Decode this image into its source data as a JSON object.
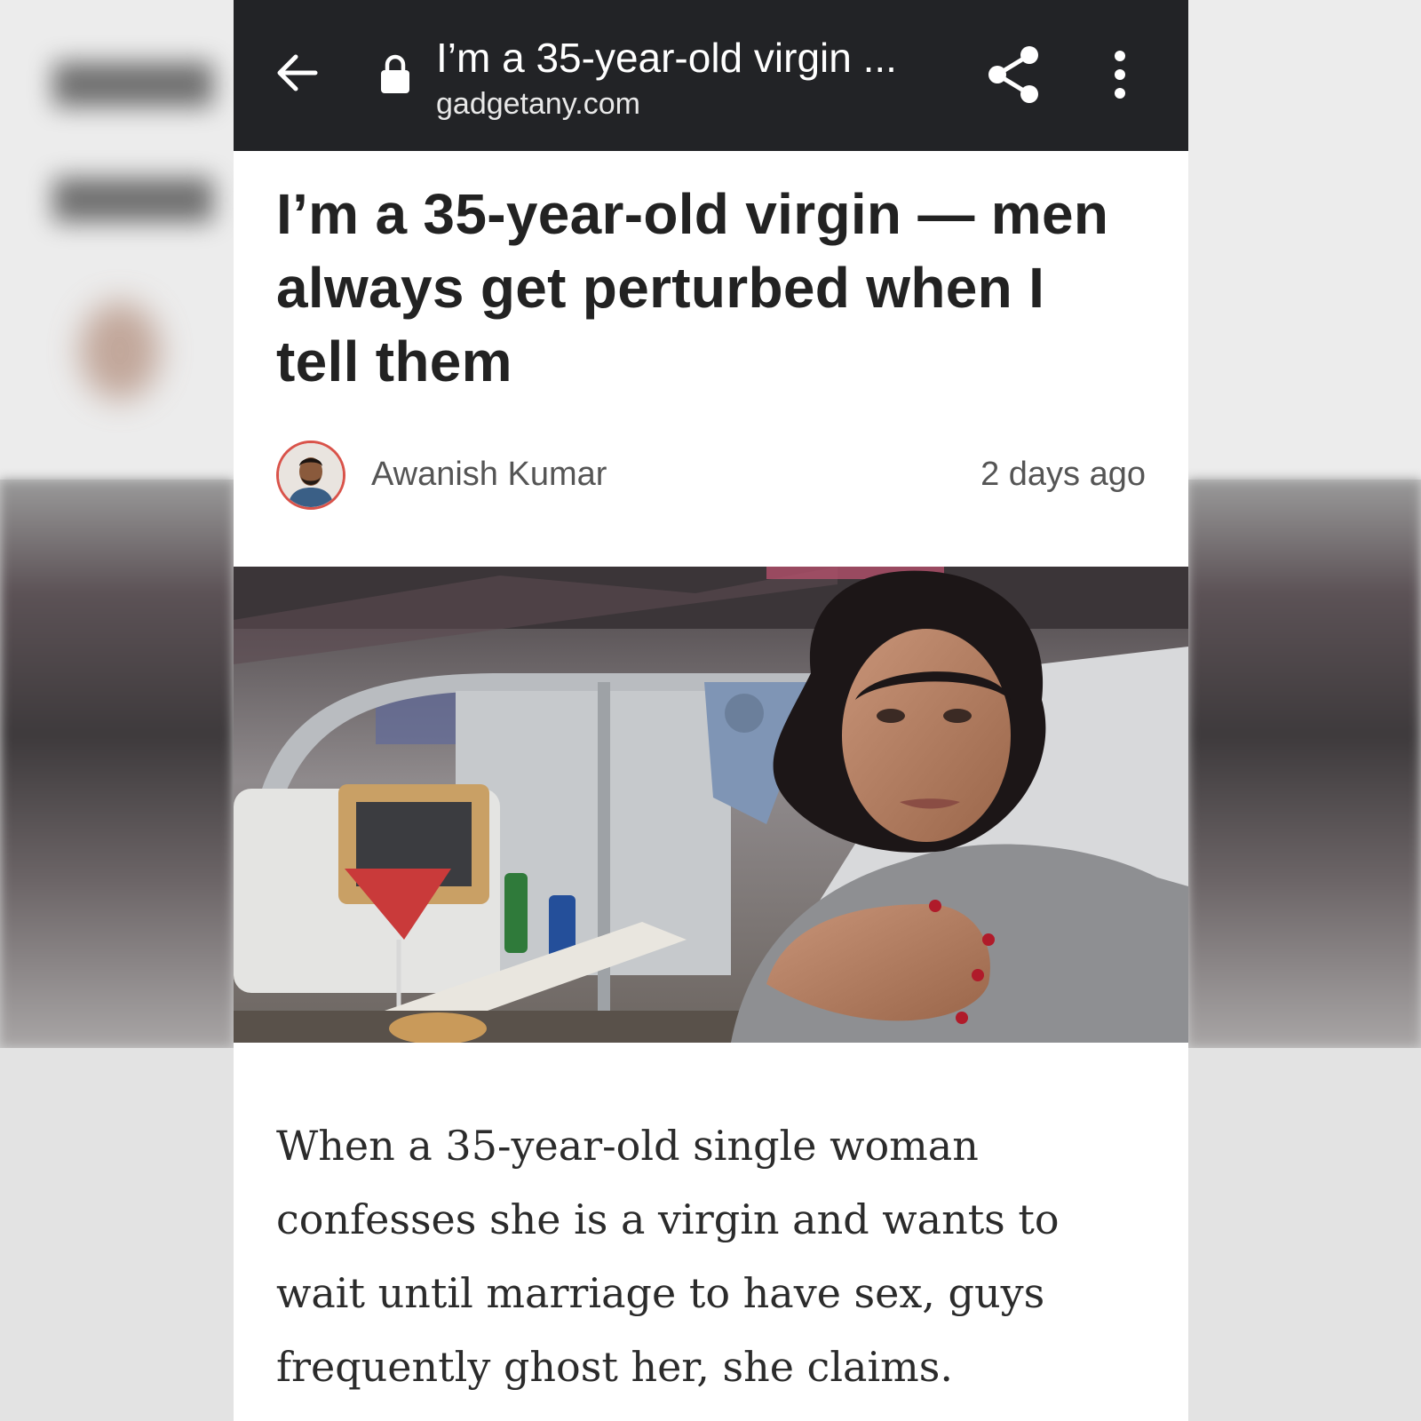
{
  "browser": {
    "tab_title": "I’m a 35-year-old virgin ...",
    "url": "gadgetany.com",
    "icons": [
      "back-arrow-icon",
      "lock-icon",
      "share-icon",
      "more-vert-icon"
    ]
  },
  "article": {
    "headline": "I’m a 35-year-old virgin — men always get perturbed when I tell them",
    "author": "Awanish Kumar",
    "published": "2 days ago",
    "body": "When a 35-year-old single woman confesses she is a virgin and wants to wait until marriage to have sex, guys frequently ghost her, she claims."
  },
  "colors": {
    "toolbar": "#222326",
    "avatar_ring": "#d9534a",
    "headline": "#222222"
  }
}
